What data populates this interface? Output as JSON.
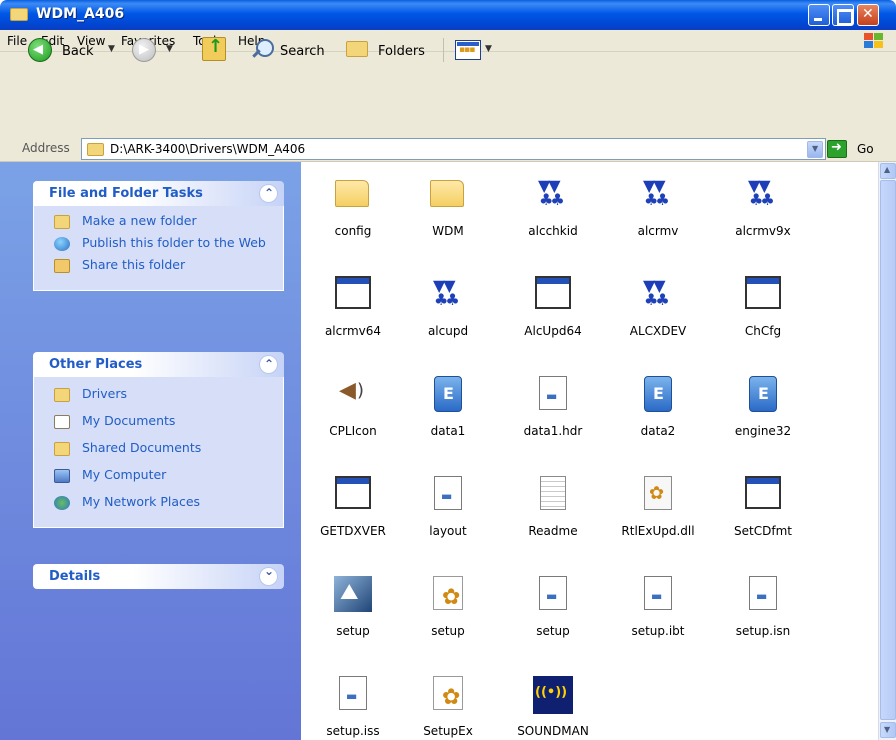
{
  "window": {
    "title": "WDM_A406"
  },
  "menu": [
    "File",
    "Edit",
    "View",
    "Favorites",
    "Tools",
    "Help"
  ],
  "toolbar": {
    "back": "Back",
    "search": "Search",
    "folders": "Folders"
  },
  "address": {
    "label": "Address",
    "path": "D:\\ARK-3400\\Drivers\\WDM_A406",
    "go": "Go"
  },
  "taskpane": {
    "file_tasks": {
      "title": "File and Folder Tasks",
      "items": [
        "Make a new folder",
        "Publish this folder to the Web",
        "Share this folder"
      ]
    },
    "other_places": {
      "title": "Other Places",
      "items": [
        "Drivers",
        "My Documents",
        "Shared Documents",
        "My Computer",
        "My Network Places"
      ]
    },
    "details": {
      "title": "Details"
    }
  },
  "files": [
    {
      "name": "config",
      "icon": "folder-icon"
    },
    {
      "name": "WDM",
      "icon": "folder-icon"
    },
    {
      "name": "alcchkid",
      "icon": "realtek-crab-icon"
    },
    {
      "name": "alcrmv",
      "icon": "realtek-crab-icon"
    },
    {
      "name": "alcrmv9x",
      "icon": "realtek-crab-icon"
    },
    {
      "name": "alcrmv64",
      "icon": "application-window-icon"
    },
    {
      "name": "alcupd",
      "icon": "realtek-crab-icon"
    },
    {
      "name": "AlcUpd64",
      "icon": "application-window-icon"
    },
    {
      "name": "ALCXDEV",
      "icon": "realtek-crab-icon"
    },
    {
      "name": "ChCfg",
      "icon": "application-window-icon"
    },
    {
      "name": "CPLIcon",
      "icon": "speaker-icon"
    },
    {
      "name": "data1",
      "icon": "cabinet-icon"
    },
    {
      "name": "data1.hdr",
      "icon": "document-icon"
    },
    {
      "name": "data2",
      "icon": "cabinet-icon"
    },
    {
      "name": "engine32",
      "icon": "cabinet-icon"
    },
    {
      "name": "GETDXVER",
      "icon": "application-window-icon"
    },
    {
      "name": "layout",
      "icon": "document-icon"
    },
    {
      "name": "Readme",
      "icon": "text-file-icon"
    },
    {
      "name": "RtlExUpd.dll",
      "icon": "dll-gear-icon"
    },
    {
      "name": "SetCDfmt",
      "icon": "application-window-icon"
    },
    {
      "name": "setup",
      "icon": "setup-image-icon"
    },
    {
      "name": "setup",
      "icon": "setup-exe-icon"
    },
    {
      "name": "setup",
      "icon": "document-icon"
    },
    {
      "name": "setup.ibt",
      "icon": "document-icon"
    },
    {
      "name": "setup.isn",
      "icon": "document-icon"
    },
    {
      "name": "setup.iss",
      "icon": "document-icon"
    },
    {
      "name": "SetupEx",
      "icon": "setup-exe-icon"
    },
    {
      "name": "SOUNDMAN",
      "icon": "sound-manager-icon"
    }
  ]
}
